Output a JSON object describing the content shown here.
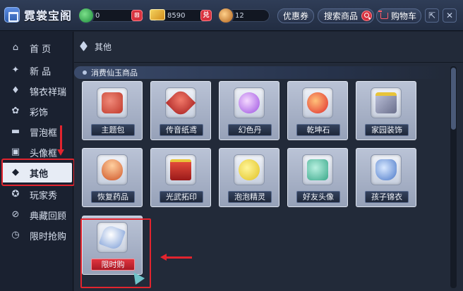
{
  "app": {
    "title": "霓裳宝阁"
  },
  "currencies": [
    {
      "name": "jade",
      "value": "0",
      "color": "#2fb34a",
      "add_label": "⊞"
    },
    {
      "name": "ticket",
      "value": "8590",
      "color": "#e7b52e",
      "add_label": "兑"
    },
    {
      "name": "coin",
      "value": "12",
      "color": "#e58c2f",
      "add_label": ""
    }
  ],
  "header": {
    "coupon_label": "优惠券",
    "search_label": "搜索商品",
    "cart_label": "购物车",
    "restore_glyph": "⇱",
    "close_glyph": "✕"
  },
  "sidebar": {
    "items": [
      {
        "label": "首 页",
        "icon": "home-icon",
        "glyph": "⌂",
        "active": false
      },
      {
        "label": "新 品",
        "icon": "gift-icon",
        "glyph": "✦",
        "active": false
      },
      {
        "label": "锦衣祥瑞",
        "icon": "shirt-icon",
        "glyph": "♦",
        "active": false
      },
      {
        "label": "彩饰",
        "icon": "ornament-icon",
        "glyph": "✿",
        "active": false
      },
      {
        "label": "冒泡框",
        "icon": "speech-bubble-icon",
        "glyph": "▬",
        "active": false
      },
      {
        "label": "头像框",
        "icon": "portrait-frame-icon",
        "glyph": "▣",
        "active": false
      },
      {
        "label": "其他",
        "icon": "cube-icon",
        "glyph": "◆",
        "active": true
      },
      {
        "label": "玩家秀",
        "icon": "player-show-icon",
        "glyph": "✪",
        "active": false
      },
      {
        "label": "典藏回顾",
        "icon": "collection-icon",
        "glyph": "⊘",
        "active": false
      },
      {
        "label": "限时抢购",
        "icon": "clock-icon",
        "glyph": "◷",
        "active": false
      }
    ]
  },
  "main": {
    "breadcrumb": "其他",
    "section_title": "消费仙玉商品",
    "items": [
      {
        "label": "主题包",
        "icon": "theme-pack-icon",
        "color": "#d9534f",
        "highlight": false
      },
      {
        "label": "传音纸鸢",
        "icon": "paper-kite-icon",
        "color": "#c0392b",
        "highlight": false
      },
      {
        "label": "幻色丹",
        "icon": "color-pill-icon",
        "color": "#b06ee8",
        "highlight": false
      },
      {
        "label": "乾坤石",
        "icon": "qiankun-stone-icon",
        "color": "#e84a3a",
        "highlight": false
      },
      {
        "label": "家园装饰",
        "icon": "home-decor-icon",
        "color": "#8c8fa8",
        "highlight": false
      },
      {
        "label": "恢复药品",
        "icon": "medicine-bowl-icon",
        "color": "#e06a3a",
        "highlight": false
      },
      {
        "label": "光武拓印",
        "icon": "rubbing-box-icon",
        "color": "#c52a2a",
        "highlight": false
      },
      {
        "label": "泡泡精灵",
        "icon": "bubble-sprite-icon",
        "color": "#e8d83a",
        "highlight": false
      },
      {
        "label": "好友头像",
        "icon": "friend-avatar-icon",
        "color": "#5fc9a8",
        "highlight": false
      },
      {
        "label": "孩子锦衣",
        "icon": "child-outfit-icon",
        "color": "#6f9ee0",
        "highlight": false
      },
      {
        "label": "限时购",
        "icon": "limited-time-icon",
        "color": "#9fb9e6",
        "highlight": true
      }
    ]
  }
}
